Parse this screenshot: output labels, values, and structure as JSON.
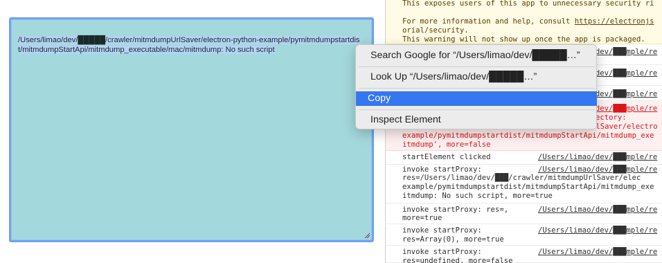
{
  "textarea": {
    "content": "/Users/limao/dev/█████/crawler/mitmdumpUrlSaver/electron-python-example/pymitmdumpstartdist/mitmdumpStartApi/mitmdump_executable/mac/mitmdump: No such script"
  },
  "context_menu": {
    "items": [
      {
        "label": "Search Google for “/Users/limao/dev/█████…”"
      },
      {
        "label": "Look Up “/Users/limao/dev/█████…”"
      },
      {
        "label": "Copy"
      },
      {
        "label": "Inspect Element"
      }
    ]
  },
  "console": {
    "warning": {
      "line1": "This exposes users of this app to unnecessary security ri",
      "line2_prefix": "For more information and help, consult ",
      "line2_link": "https://electronjs",
      "line3": "orial/security.",
      "line4": "This warning will not show up once the app is packaged."
    },
    "rows": [
      {
        "msg": "",
        "src": "/Users/limao/dev/███mple/re"
      },
      {
        "msg": "",
        "src": "/Users/limao/dev/███mple/re"
      },
      {
        "msg": "",
        "src": "/Users/limao/dev/███mple/re"
      },
      {
        "msg": "",
        "src": "/Users/limao/dev/███mple/re"
      }
    ],
    "error": {
      "line1": "ectory:",
      "line2": "rlSaver/electro",
      "line3": "example/pymitmdumpstartdist/mitmdumpStartApi/mitmdump_exe",
      "line4": "itmdump', more=false"
    },
    "entries": [
      {
        "lines": [
          "startElement clicked"
        ],
        "src": "/Users/limao/dev/███mple/re"
      },
      {
        "lines": [
          "invoke startProxy:",
          "res=/Users/limao/dev/███/crawler/mitmdumpUrlSaver/elec",
          "example/pymitmdumpstartdist/mitmdumpStartApi/mitmdump_exe",
          "itmdump: No such script, more=true"
        ],
        "src": "/Users/limao/dev/███mple/re"
      },
      {
        "lines": [
          "invoke startProxy: res=,",
          "more=true"
        ],
        "src": "/Users/limao/dev/███mple/re"
      },
      {
        "lines": [
          "invoke startProxy:",
          "res=Array(0), more=true"
        ],
        "src": "/Users/limao/dev/███mple/re"
      },
      {
        "lines": [
          "invoke startProxy:",
          "res=undefined, more=false"
        ],
        "src": "/Users/limao/dev/███mple/re"
      }
    ]
  },
  "colors": {
    "textarea_bg": "#a3d8dc",
    "focus_ring": "#6fa2f0",
    "menu_highlight": "#3577f0",
    "error_text": "#d8161a",
    "warning_bg": "#fffbe5"
  }
}
